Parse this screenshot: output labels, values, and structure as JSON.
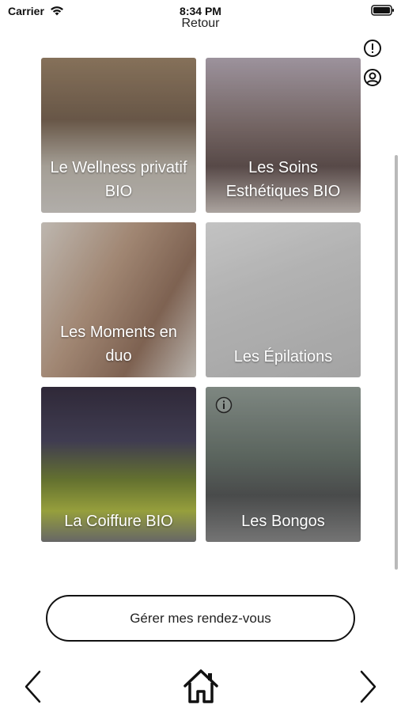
{
  "status_bar": {
    "carrier": "Carrier",
    "time": "8:34 PM"
  },
  "nav": {
    "back_label": "Retour"
  },
  "tiles": [
    {
      "label": "Le Wellness privatif BIO"
    },
    {
      "label": "Les Soins Esthétiques BIO"
    },
    {
      "label": "Les Moments en duo"
    },
    {
      "label": "Les Épilations"
    },
    {
      "label": "La Coiffure BIO"
    },
    {
      "label": "Les Bongos"
    }
  ],
  "actions": {
    "manage_label": "Gérer mes rendez-vous"
  },
  "icons": {
    "alert": "alert-icon",
    "profile": "profile-icon",
    "info": "info-icon",
    "prev": "chevron-left-icon",
    "home": "home-icon",
    "next": "chevron-right-icon"
  }
}
